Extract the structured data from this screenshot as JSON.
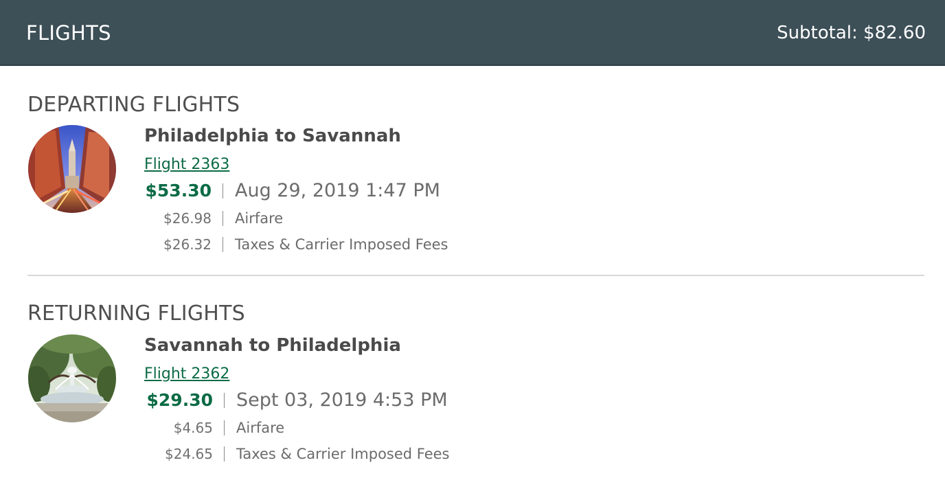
{
  "header": {
    "title": "FLIGHTS",
    "subtotal": "Subtotal: $82.60"
  },
  "departing": {
    "section_title": "DEPARTING FLIGHTS",
    "route": "Philadelphia to Savannah",
    "flight_link": "Flight 2363",
    "total_price": "$53.30",
    "datetime": "Aug 29, 2019 1:47 PM",
    "breakdown": [
      {
        "amount": "$26.98",
        "label": "Airfare"
      },
      {
        "amount": "$26.32",
        "label": "Taxes & Carrier Imposed Fees"
      }
    ]
  },
  "returning": {
    "section_title": "RETURNING FLIGHTS",
    "route": "Savannah to Philadelphia",
    "flight_link": "Flight 2362",
    "total_price": "$29.30",
    "datetime": "Sept 03, 2019 4:53 PM",
    "breakdown": [
      {
        "amount": "$4.65",
        "label": "Airfare"
      },
      {
        "amount": "$24.65",
        "label": "Taxes & Carrier Imposed Fees"
      }
    ]
  },
  "colors": {
    "header_bg": "#3d4f57",
    "price_green": "#0c6b45",
    "link_green": "#0c6b45"
  }
}
